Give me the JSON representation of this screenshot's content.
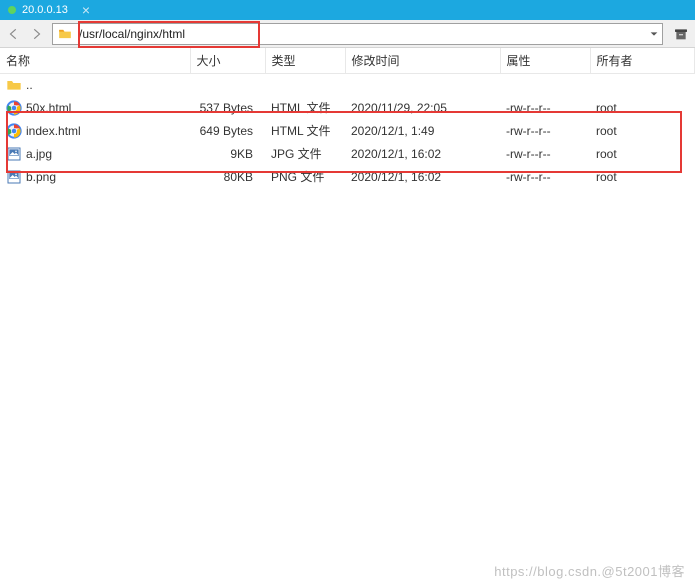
{
  "tab": {
    "title": "20.0.0.13",
    "close": "×"
  },
  "path": "/usr/local/nginx/html",
  "columns": {
    "name": "名称",
    "size": "大小",
    "type": "类型",
    "date": "修改时间",
    "attr": "属性",
    "owner": "所有者"
  },
  "rows": [
    {
      "name": "..",
      "size": "",
      "type": "",
      "date": "",
      "attr": "",
      "owner": "",
      "icon": "folder-up"
    },
    {
      "name": "50x.html",
      "size": "537 Bytes",
      "type": "HTML 文件",
      "date": "2020/11/29, 22:05",
      "attr": "-rw-r--r--",
      "owner": "root",
      "icon": "chrome"
    },
    {
      "name": "index.html",
      "size": "649 Bytes",
      "type": "HTML 文件",
      "date": "2020/12/1, 1:49",
      "attr": "-rw-r--r--",
      "owner": "root",
      "icon": "chrome"
    },
    {
      "name": "a.jpg",
      "size": "9KB",
      "type": "JPG 文件",
      "date": "2020/12/1, 16:02",
      "attr": "-rw-r--r--",
      "owner": "root",
      "icon": "jpg"
    },
    {
      "name": "b.png",
      "size": "80KB",
      "type": "PNG 文件",
      "date": "2020/12/1, 16:02",
      "attr": "-rw-r--r--",
      "owner": "root",
      "icon": "png"
    }
  ],
  "watermark": "https://blog.csdn.@5t2001博客"
}
